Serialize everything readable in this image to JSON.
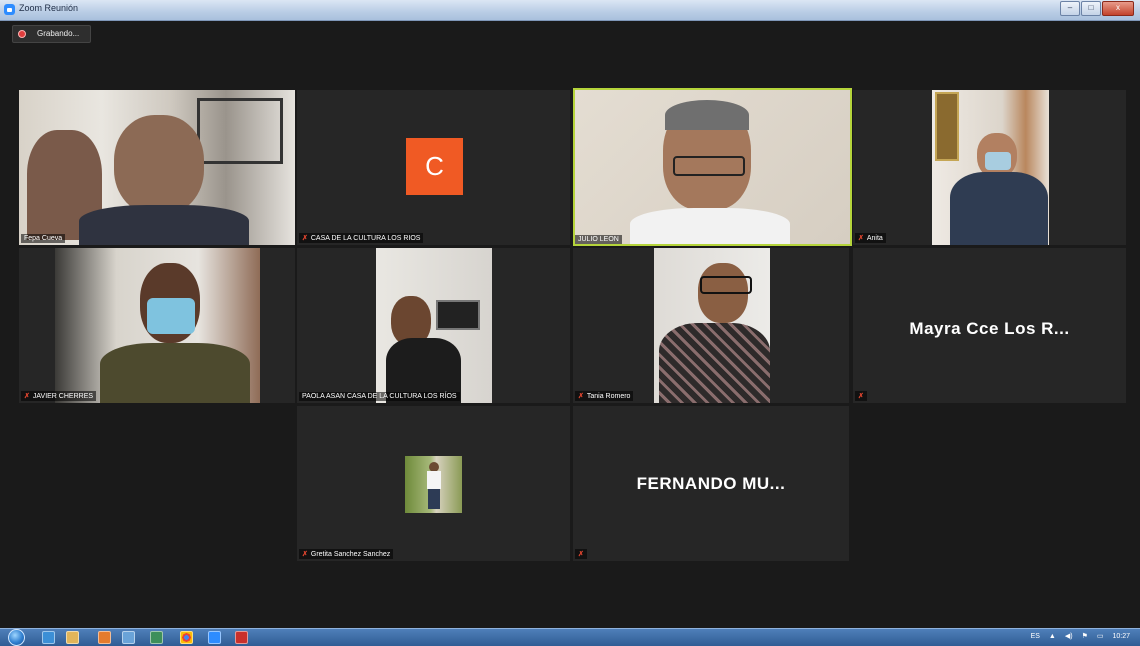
{
  "window": {
    "title": "Zoom Reunión",
    "controls": {
      "minimize": "–",
      "maximize": "□",
      "close": "x"
    }
  },
  "recording": {
    "label": "Grabando..."
  },
  "participants": [
    {
      "name": "Fepa Cueva",
      "muted": false,
      "video": true
    },
    {
      "name": "CASA DE LA CULTURA LOS RIOS",
      "muted": true,
      "video": false,
      "avatar_letter": "C",
      "avatar_color": "#f05a24"
    },
    {
      "name": "JULIO LEON",
      "muted": false,
      "video": true,
      "active_speaker": true
    },
    {
      "name": "Anita",
      "muted": true,
      "video": true
    },
    {
      "name": "JAVIER CHERRES",
      "muted": true,
      "video": true
    },
    {
      "name": "PAOLA ASAN CASA DE LA CULTURA LOS RÍOS",
      "muted": false,
      "video": true
    },
    {
      "name": "Tania Romero",
      "muted": true,
      "video": true
    },
    {
      "name": "",
      "muted": true,
      "video": false,
      "display_name": "Mayra Cce Los R..."
    },
    {
      "name": "Gretita Sanchez Sanchez",
      "muted": true,
      "video": true
    },
    {
      "name": "",
      "muted": true,
      "video": false,
      "display_name": "FERNANDO MU..."
    }
  ],
  "mute_glyph": "✗",
  "colors": {
    "active_speaker_border": "#b5d43b",
    "muted_icon": "#e0452f",
    "background": "#1a1a1a"
  },
  "taskbar": {
    "icons": [
      "start-orb",
      "internet-explorer-icon",
      "file-explorer-icon",
      "media-player-icon",
      "window-icon",
      "window-icon",
      "chrome-icon",
      "zoom-icon",
      "pdf-icon"
    ],
    "tray": {
      "language": "ES",
      "time": "10:27"
    }
  }
}
